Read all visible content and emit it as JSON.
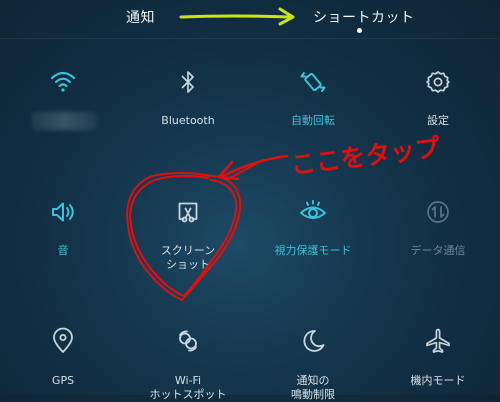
{
  "header": {
    "tab_notify": "通知",
    "tab_shortcut": "ショートカット"
  },
  "annotation": {
    "text": "ここをタップ"
  },
  "toggles": {
    "wifi": {
      "label": "",
      "icon": "wifi-icon",
      "state": "active"
    },
    "bluetooth": {
      "label": "Bluetooth",
      "icon": "bluetooth-icon",
      "state": "inactive"
    },
    "auto_rotate": {
      "label": "自動回転",
      "icon": "rotate-icon",
      "state": "active"
    },
    "settings": {
      "label": "設定",
      "icon": "gear-icon",
      "state": "inactive"
    },
    "sound": {
      "label": "音",
      "icon": "speaker-icon",
      "state": "active"
    },
    "screenshot": {
      "label_line1": "スクリーン",
      "label_line2": "ショット",
      "icon": "screenshot-icon",
      "state": "inactive"
    },
    "eye_comfort": {
      "label": "視力保護モード",
      "icon": "eye-icon",
      "state": "active"
    },
    "mobile_data": {
      "label": "データ通信",
      "icon": "data-icon",
      "state": "disabled"
    },
    "gps": {
      "label": "GPS",
      "icon": "location-pin-icon",
      "state": "inactive"
    },
    "wifi_hotspot": {
      "label_line1": "Wi-Fi",
      "label_line2": "ホットスポット",
      "icon": "hotspot-icon",
      "state": "inactive"
    },
    "do_not_disturb": {
      "label_line1": "通知の",
      "label_line2": "鳴動制限",
      "icon": "moon-icon",
      "state": "inactive"
    },
    "airplane_mode": {
      "label": "機内モード",
      "icon": "airplane-icon",
      "state": "inactive"
    }
  },
  "colors": {
    "accent": "#3fc0d8",
    "inactive": "#d6e0e6",
    "disabled": "#6c8594",
    "annotation_red": "#e01010",
    "annotation_yellow": "#c8e612"
  }
}
